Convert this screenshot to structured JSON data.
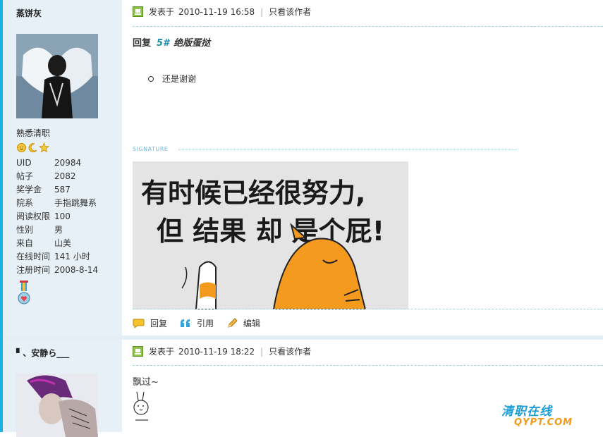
{
  "post1": {
    "author": "蒸饼灰",
    "rank": "熟悉清职",
    "stats": [
      {
        "k": "UID",
        "v": "20984"
      },
      {
        "k": "帖子",
        "v": "2082"
      },
      {
        "k": "奖学金",
        "v": "587"
      },
      {
        "k": "院系",
        "v": "手指跳舞系"
      },
      {
        "k": "阅读权限",
        "v": "100"
      },
      {
        "k": "性别",
        "v": "男"
      },
      {
        "k": "来自",
        "v": "山美"
      },
      {
        "k": "在线时间",
        "v": "141 小时"
      },
      {
        "k": "注册时间",
        "v": "2008-8-14"
      }
    ],
    "posted_label": "发表于",
    "posted_time": "2010-11-19 16:58",
    "only_author": "只看该作者",
    "reply_prefix": "回复",
    "reply_num": "5#",
    "reply_name": "绝版蛋挞",
    "quote_text": "还是谢谢",
    "signature_label": "SIGNATURE",
    "sig_line1": "有时候已经很努力,",
    "sig_line2": "但 结果 却 是个屁!"
  },
  "actions": {
    "reply": "回复",
    "quote": "引用",
    "edit": "编辑"
  },
  "post2": {
    "author": "▘、安静ら___",
    "posted_label": "发表于",
    "posted_time": "2010-11-19 18:22",
    "only_author": "只看该作者",
    "content": "飘过~"
  },
  "watermark": {
    "line1": "清职在线",
    "line2": "QYPT.COM"
  },
  "colors": {
    "accent": "#1ab2e8",
    "sidebar_bg": "#e7f0f7",
    "link_blue": "#1a8eb0"
  }
}
